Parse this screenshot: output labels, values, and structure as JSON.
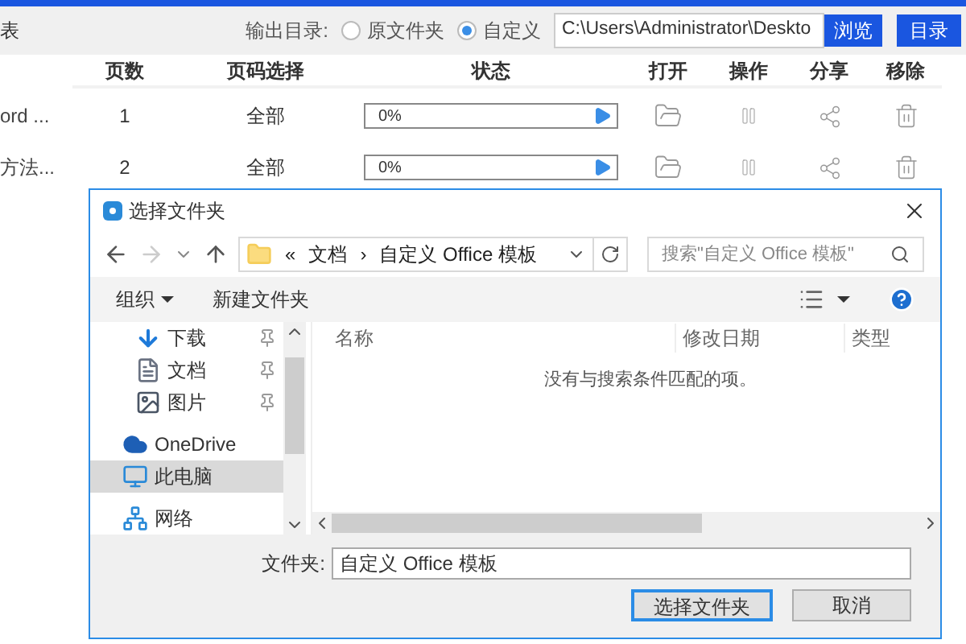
{
  "toolbar": {
    "left_label": "表",
    "output_label": "输出目录:",
    "radios": [
      {
        "label": "原文件夹",
        "selected": false
      },
      {
        "label": "自定义",
        "selected": true
      }
    ],
    "path": "C:\\Users\\Administrator\\Deskto",
    "browse": "浏览",
    "dir_button": "目录"
  },
  "table": {
    "columns": [
      "页数",
      "页码选择",
      "状态",
      "打开",
      "操作",
      "分享",
      "移除"
    ],
    "rows": [
      {
        "name": "ord ...",
        "pages": "1",
        "range": "全部",
        "progress": "0%",
        "level": 0
      },
      {
        "name": "方法...",
        "pages": "2",
        "range": "全部",
        "progress": "0%",
        "level": 0
      }
    ]
  },
  "dialog": {
    "title": "选择文件夹",
    "breadcrumb": [
      "«",
      "文档",
      "›",
      "自定义 Office 模板"
    ],
    "search_placeholder": "搜索\"自定义 Office 模板\"",
    "organize": "组织",
    "new_folder": "新建文件夹",
    "nav_items": [
      {
        "label": "下载",
        "kind": "download",
        "pinned": true,
        "selected": false
      },
      {
        "label": "文档",
        "kind": "document",
        "pinned": true,
        "selected": false
      },
      {
        "label": "图片",
        "kind": "image",
        "pinned": true,
        "selected": false
      },
      {
        "label": "OneDrive",
        "kind": "cloud",
        "pinned": false,
        "selected": false
      },
      {
        "label": "此电脑",
        "kind": "computer",
        "pinned": false,
        "selected": true
      },
      {
        "label": "网络",
        "kind": "network",
        "pinned": false,
        "selected": false
      }
    ],
    "columns": [
      "名称",
      "修改日期",
      "类型"
    ],
    "empty_message": "没有与搜索条件匹配的项。",
    "folder_label": "文件夹:",
    "folder_value": "自定义 Office 模板",
    "ok": "选择文件夹",
    "cancel": "取消"
  }
}
